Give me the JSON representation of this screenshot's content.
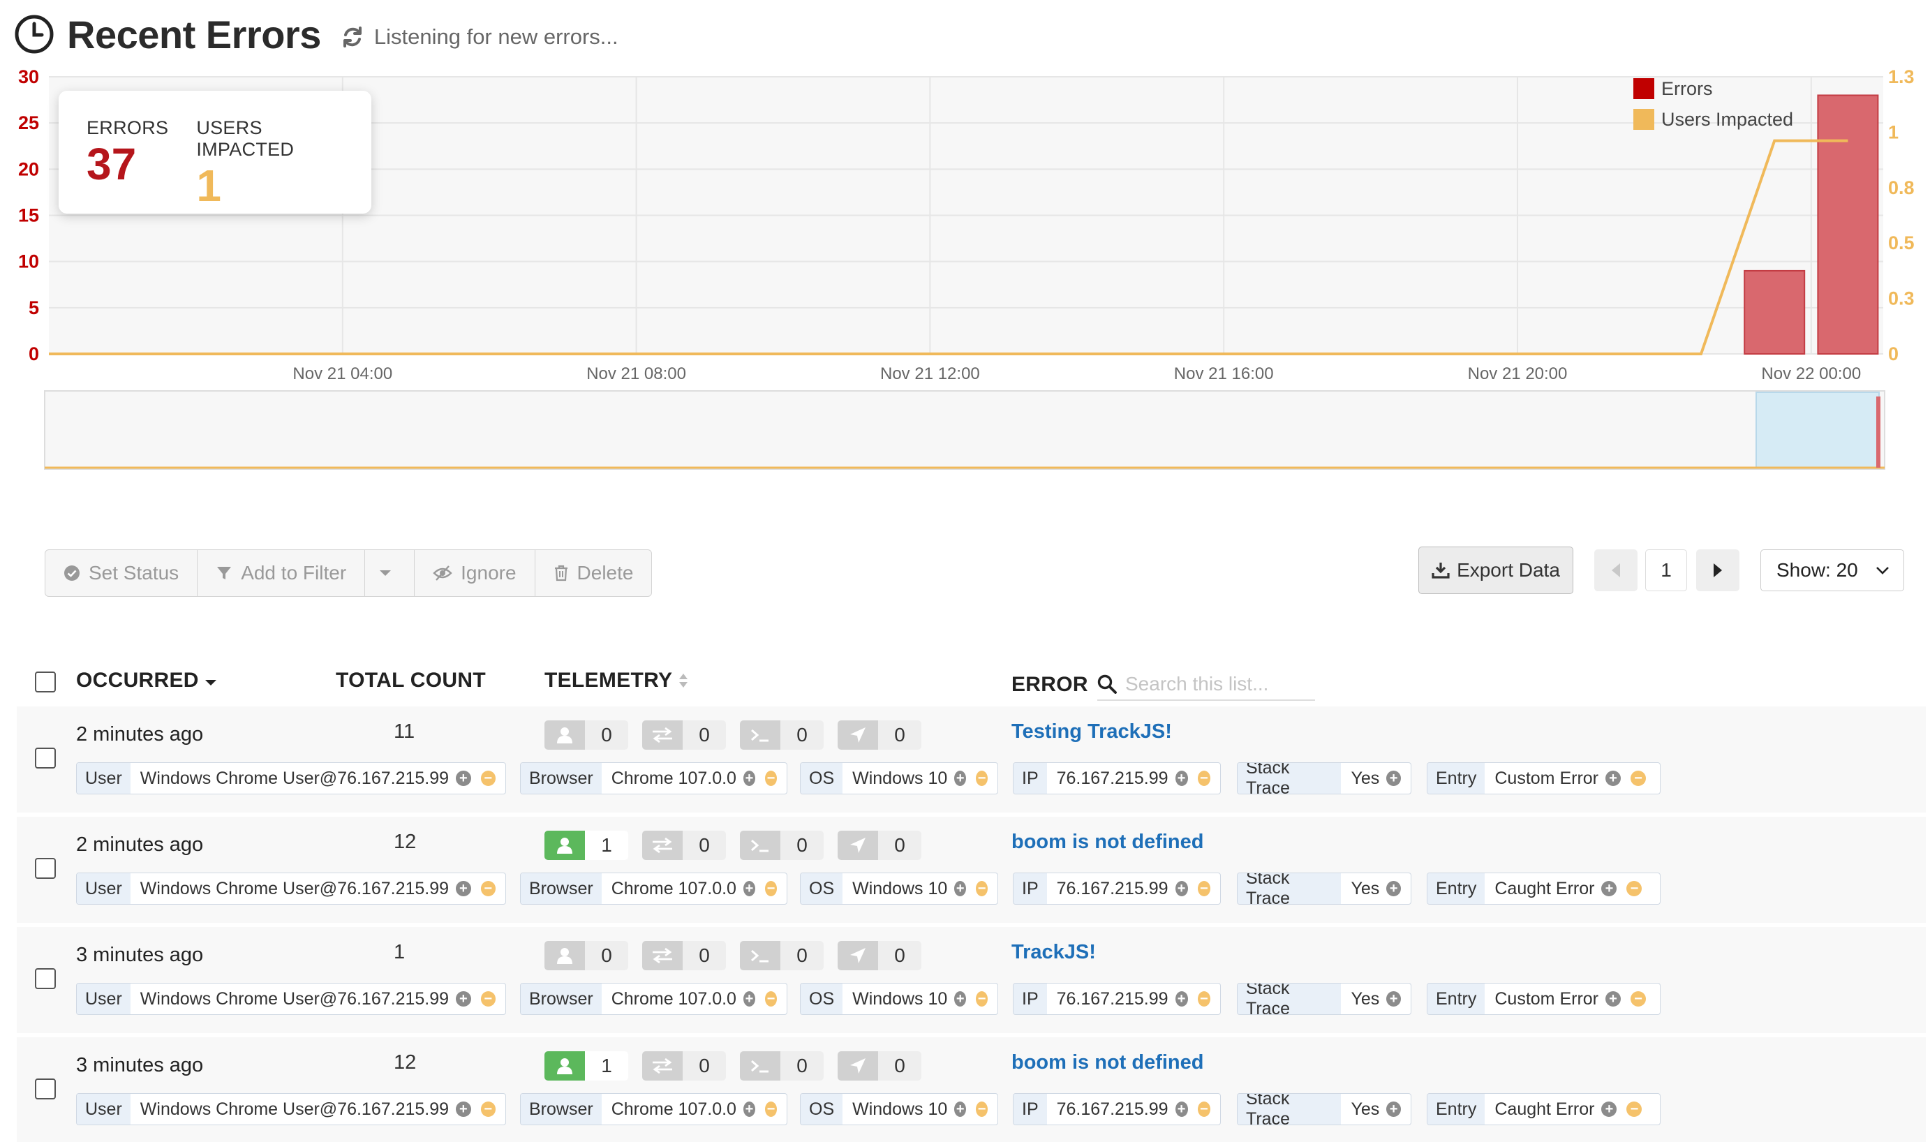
{
  "header": {
    "title": "Recent Errors",
    "status": "Listening for new errors..."
  },
  "stats": {
    "errors_label": "ERRORS",
    "errors_value": "37",
    "users_label": "USERS IMPACTED",
    "users_value": "1"
  },
  "chart_data": {
    "type": "bar",
    "x_ticks": [
      "Nov 21 04:00",
      "Nov 21 08:00",
      "Nov 21 12:00",
      "Nov 21 16:00",
      "Nov 21 20:00",
      "Nov 22 00:00"
    ],
    "y_left_ticks": [
      "30",
      "25",
      "20",
      "15",
      "10",
      "5",
      "0"
    ],
    "y_right_ticks": [
      "1.3",
      "1",
      "0.8",
      "0.5",
      "0.3",
      "0"
    ],
    "y_left_range": [
      0,
      30
    ],
    "y_right_range": [
      0,
      1.3
    ],
    "series": [
      {
        "name": "Errors",
        "type": "bar",
        "color": "#c00000",
        "points": [
          {
            "x": "Nov 21 23:30",
            "y": 9
          },
          {
            "x": "Nov 22 00:30",
            "y": 28
          }
        ]
      },
      {
        "name": "Users Impacted",
        "type": "line",
        "color": "#f0b95a",
        "points": [
          {
            "x": "Nov 21 00:00",
            "y": 0
          },
          {
            "x": "Nov 21 22:30",
            "y": 0
          },
          {
            "x": "Nov 21 23:30",
            "y": 1
          },
          {
            "x": "Nov 22 00:30",
            "y": 1
          }
        ]
      }
    ],
    "legend": {
      "position": "top-right",
      "items": [
        "Errors",
        "Users Impacted"
      ]
    },
    "grid": true
  },
  "toolbar": {
    "set_status": "Set Status",
    "add_to_filter": "Add to Filter",
    "ignore": "Ignore",
    "delete": "Delete",
    "export": "Export Data",
    "page": "1",
    "show": "Show: 20"
  },
  "table": {
    "headers": {
      "occurred": "OCCURRED",
      "total_count": "TOTAL COUNT",
      "telemetry": "TELEMETRY",
      "error": "ERROR"
    },
    "search_placeholder": "Search this list...",
    "rows": [
      {
        "occurred": "2 minutes ago",
        "count": "11",
        "telemetry": {
          "users": "0",
          "network": "0",
          "console": "0",
          "navigation": "0"
        },
        "users_active": false,
        "error": "Testing TrackJS!",
        "tags": {
          "user_key": "User",
          "user": "Windows Chrome User@76.167.215.99",
          "browser_key": "Browser",
          "browser": "Chrome 107.0.0",
          "os_key": "OS",
          "os": "Windows 10",
          "ip_key": "IP",
          "ip": "76.167.215.99",
          "stack_key": "Stack Trace",
          "stack": "Yes",
          "entry_key": "Entry",
          "entry": "Custom Error"
        }
      },
      {
        "occurred": "2 minutes ago",
        "count": "12",
        "telemetry": {
          "users": "1",
          "network": "0",
          "console": "0",
          "navigation": "0"
        },
        "users_active": true,
        "error": "boom is not defined",
        "tags": {
          "user_key": "User",
          "user": "Windows Chrome User@76.167.215.99",
          "browser_key": "Browser",
          "browser": "Chrome 107.0.0",
          "os_key": "OS",
          "os": "Windows 10",
          "ip_key": "IP",
          "ip": "76.167.215.99",
          "stack_key": "Stack Trace",
          "stack": "Yes",
          "entry_key": "Entry",
          "entry": "Caught Error"
        }
      },
      {
        "occurred": "3 minutes ago",
        "count": "1",
        "telemetry": {
          "users": "0",
          "network": "0",
          "console": "0",
          "navigation": "0"
        },
        "users_active": false,
        "error": "TrackJS!",
        "tags": {
          "user_key": "User",
          "user": "Windows Chrome User@76.167.215.99",
          "browser_key": "Browser",
          "browser": "Chrome 107.0.0",
          "os_key": "OS",
          "os": "Windows 10",
          "ip_key": "IP",
          "ip": "76.167.215.99",
          "stack_key": "Stack Trace",
          "stack": "Yes",
          "entry_key": "Entry",
          "entry": "Custom Error"
        }
      },
      {
        "occurred": "3 minutes ago",
        "count": "12",
        "telemetry": {
          "users": "1",
          "network": "0",
          "console": "0",
          "navigation": "0"
        },
        "users_active": true,
        "error": "boom is not defined",
        "tags": {
          "user_key": "User",
          "user": "Windows Chrome User@76.167.215.99",
          "browser_key": "Browser",
          "browser": "Chrome 107.0.0",
          "os_key": "OS",
          "os": "Windows 10",
          "ip_key": "IP",
          "ip": "76.167.215.99",
          "stack_key": "Stack Trace",
          "stack": "Yes",
          "entry_key": "Entry",
          "entry": "Caught Error"
        }
      }
    ]
  }
}
